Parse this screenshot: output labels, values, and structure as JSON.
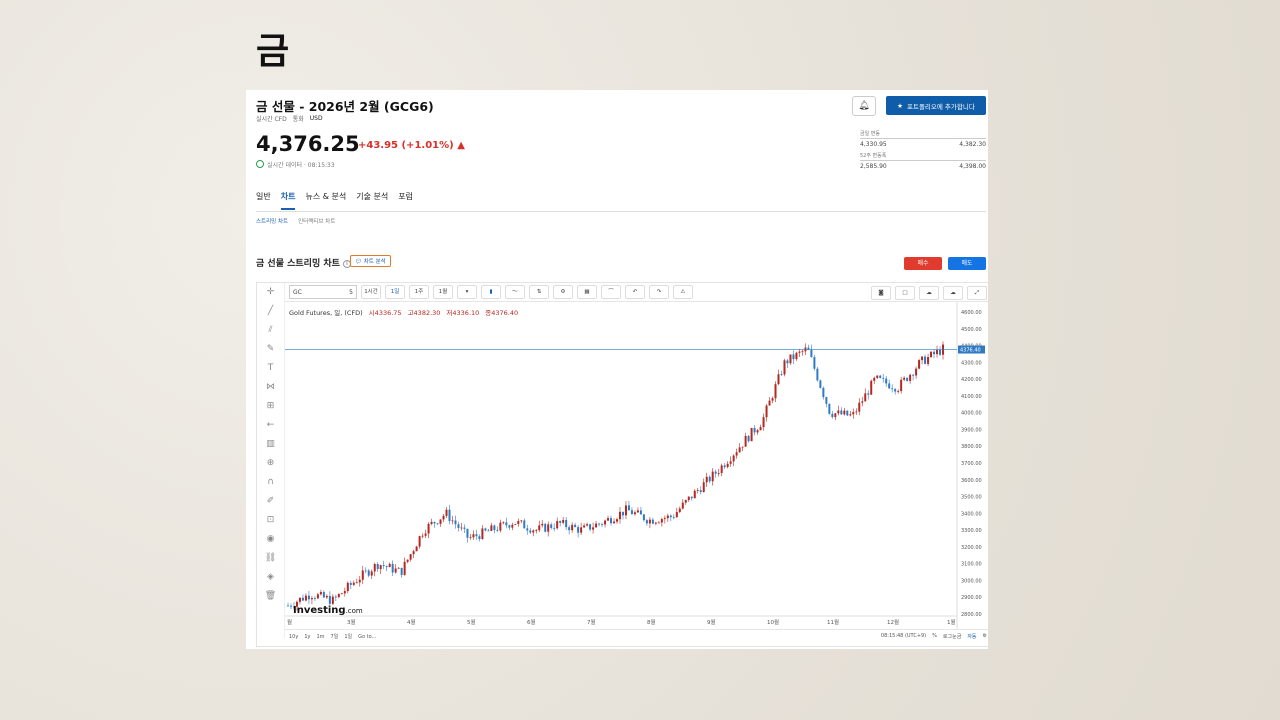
{
  "slide": {
    "title": "금"
  },
  "header": {
    "instrument_title": "금 선물 - 2026년 2월 (GCG6)",
    "meta_label": "실시간 CFD",
    "currency_label": "통화",
    "currency_value": "USD",
    "price": "4,376.25",
    "change": "+43.95 (+1.01%)",
    "realtime": "실시간 데이터 · 08:15:33",
    "bell_icon": "bell-icon",
    "portfolio_button": "포트폴리오에 추가합니다",
    "day_range": {
      "label": "금일 변동",
      "low": "4,330.95",
      "high": "4,382.30"
    },
    "week52_range": {
      "label": "52주 변동폭",
      "low": "2,585.90",
      "high": "4,398.00"
    }
  },
  "tabs": [
    {
      "label": "일반",
      "active": false
    },
    {
      "label": "차트",
      "active": true
    },
    {
      "label": "뉴스 & 분석",
      "active": false
    },
    {
      "label": "기술 분석",
      "active": false
    },
    {
      "label": "포럼",
      "active": false
    }
  ],
  "subtabs": [
    {
      "label": "스트리밍 차트",
      "active": true
    },
    {
      "label": "인터랙티브 차트",
      "active": false
    }
  ],
  "section": {
    "title": "금 선물 스트리밍 차트",
    "analysis_button": "차트 분석",
    "buy_button": "매수",
    "sell_button": "매도"
  },
  "toolbar": {
    "symbol": "GC",
    "symbol_suffix": "5",
    "intervals": [
      "1시간",
      "1일",
      "1주",
      "1월"
    ],
    "active_interval": "1일"
  },
  "legend": {
    "name": "Gold Futures, 일, (CFD)",
    "open": "시4336.75",
    "high": "고4382.30",
    "low": "저4336.10",
    "close": "종4376.40"
  },
  "logo": {
    "brand": "Investing",
    "suffix": ".com"
  },
  "bottom": {
    "ranges": [
      "10y",
      "1y",
      "1m",
      "7일",
      "1일",
      "Go to..."
    ],
    "clock": "08:15:48 (UTC+9)",
    "pct": "%",
    "log": "로그눈금",
    "auto": "자동"
  },
  "chart_data": {
    "type": "candlestick",
    "x_tick_labels": [
      "월",
      "3월",
      "4월",
      "5월",
      "6월",
      "7월",
      "8월",
      "9월",
      "10월",
      "11월",
      "12월",
      "1월"
    ],
    "y_tick_labels": [
      "4600.00",
      "4500.00",
      "4400.00",
      "4300.00",
      "4200.00",
      "4100.00",
      "4000.00",
      "3900.00",
      "3800.00",
      "3700.00",
      "3600.00",
      "3500.00",
      "3400.00",
      "3300.00",
      "3200.00",
      "3100.00",
      "3000.00",
      "2900.00",
      "2800.00"
    ],
    "ylim": [
      2800,
      4600
    ],
    "last_price_label": "4376.40",
    "last_price": 4376.4,
    "up_color": "#b5271f",
    "down_color": "#2e7bc4",
    "monthly_path": [
      2850,
      2920,
      2880,
      3000,
      3100,
      3050,
      3300,
      3400,
      3250,
      3300,
      3350,
      3300,
      3340,
      3300,
      3350,
      3420,
      3360,
      3380,
      3520,
      3650,
      3800,
      3950,
      4300,
      4380,
      4000,
      3980,
      4200,
      4150,
      4300,
      4380
    ]
  }
}
